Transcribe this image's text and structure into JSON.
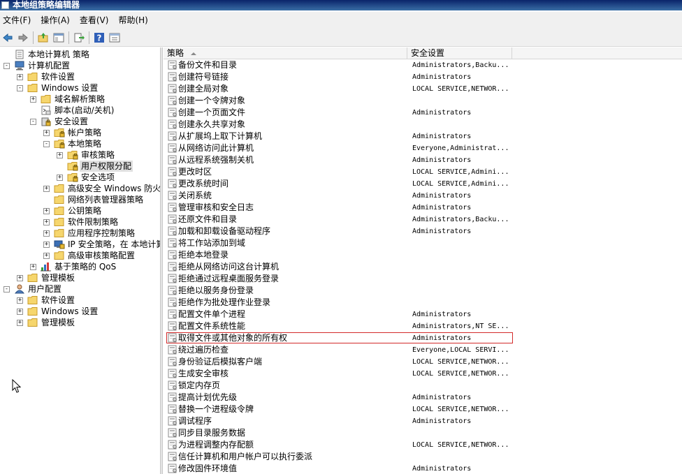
{
  "window": {
    "title": "本地组策略编辑器"
  },
  "menu": [
    "文件(F)",
    "操作(A)",
    "查看(V)",
    "帮助(H)"
  ],
  "toolbar": {
    "buttons": [
      "back-icon",
      "forward-icon",
      "up-folder-icon",
      "show-hide-tree-icon",
      "export-list-icon",
      "help-icon",
      "properties-view-icon"
    ]
  },
  "tree": [
    {
      "label": "本地计算机 策略",
      "depth": 0,
      "expander": "",
      "icon": "policy-doc-icon"
    },
    {
      "label": "计算机配置",
      "depth": 0,
      "expander": "-",
      "icon": "computer-icon"
    },
    {
      "label": "软件设置",
      "depth": 1,
      "expander": "+",
      "icon": "folder-icon"
    },
    {
      "label": "Windows 设置",
      "depth": 1,
      "expander": "-",
      "icon": "folder-icon"
    },
    {
      "label": "域名解析策略",
      "depth": 2,
      "expander": "+",
      "icon": "folder-icon"
    },
    {
      "label": "脚本(启动/关机)",
      "depth": 2,
      "expander": "",
      "icon": "script-icon"
    },
    {
      "label": "安全设置",
      "depth": 2,
      "expander": "-",
      "icon": "security-settings-icon"
    },
    {
      "label": "帐户策略",
      "depth": 3,
      "expander": "+",
      "icon": "secure-folder-icon"
    },
    {
      "label": "本地策略",
      "depth": 3,
      "expander": "-",
      "icon": "secure-folder-icon"
    },
    {
      "label": "审核策略",
      "depth": 4,
      "expander": "+",
      "icon": "secure-folder-icon"
    },
    {
      "label": "用户权限分配",
      "depth": 4,
      "expander": "",
      "icon": "secure-folder-icon",
      "selected": true
    },
    {
      "label": "安全选项",
      "depth": 4,
      "expander": "+",
      "icon": "secure-folder-icon"
    },
    {
      "label": "高级安全 Windows 防火墙",
      "depth": 3,
      "expander": "+",
      "icon": "folder-icon"
    },
    {
      "label": "网络列表管理器策略",
      "depth": 3,
      "expander": "",
      "icon": "folder-icon"
    },
    {
      "label": "公钥策略",
      "depth": 3,
      "expander": "+",
      "icon": "folder-icon"
    },
    {
      "label": "软件限制策略",
      "depth": 3,
      "expander": "+",
      "icon": "folder-icon"
    },
    {
      "label": "应用程序控制策略",
      "depth": 3,
      "expander": "+",
      "icon": "folder-icon"
    },
    {
      "label": "IP 安全策略，在 本地计算机",
      "depth": 3,
      "expander": "+",
      "icon": "ip-security-icon"
    },
    {
      "label": "高级审核策略配置",
      "depth": 3,
      "expander": "+",
      "icon": "folder-icon"
    },
    {
      "label": "基于策略的 QoS",
      "depth": 2,
      "expander": "+",
      "icon": "qos-chart-icon"
    },
    {
      "label": "管理模板",
      "depth": 1,
      "expander": "+",
      "icon": "folder-icon"
    },
    {
      "label": "用户配置",
      "depth": 0,
      "expander": "-",
      "icon": "user-icon"
    },
    {
      "label": "软件设置",
      "depth": 1,
      "expander": "+",
      "icon": "folder-icon"
    },
    {
      "label": "Windows 设置",
      "depth": 1,
      "expander": "+",
      "icon": "folder-icon"
    },
    {
      "label": "管理模板",
      "depth": 1,
      "expander": "+",
      "icon": "folder-icon"
    }
  ],
  "list": {
    "columns": [
      "策略",
      "安全设置"
    ],
    "rows": [
      {
        "policy": "备份文件和目录",
        "setting": "Administrators,Backu..."
      },
      {
        "policy": "创建符号链接",
        "setting": "Administrators"
      },
      {
        "policy": "创建全局对象",
        "setting": "LOCAL SERVICE,NETWOR..."
      },
      {
        "policy": "创建一个令牌对象",
        "setting": ""
      },
      {
        "policy": "创建一个页面文件",
        "setting": "Administrators"
      },
      {
        "policy": "创建永久共享对象",
        "setting": ""
      },
      {
        "policy": "从扩展坞上取下计算机",
        "setting": "Administrators"
      },
      {
        "policy": "从网络访问此计算机",
        "setting": "Everyone,Administrat..."
      },
      {
        "policy": "从远程系统强制关机",
        "setting": "Administrators"
      },
      {
        "policy": "更改时区",
        "setting": "LOCAL SERVICE,Admini..."
      },
      {
        "policy": "更改系统时间",
        "setting": "LOCAL SERVICE,Admini..."
      },
      {
        "policy": "关闭系统",
        "setting": "Administrators"
      },
      {
        "policy": "管理审核和安全日志",
        "setting": "Administrators"
      },
      {
        "policy": "还原文件和目录",
        "setting": "Administrators,Backu..."
      },
      {
        "policy": "加载和卸载设备驱动程序",
        "setting": "Administrators"
      },
      {
        "policy": "将工作站添加到域",
        "setting": ""
      },
      {
        "policy": "拒绝本地登录",
        "setting": ""
      },
      {
        "policy": "拒绝从网络访问这台计算机",
        "setting": ""
      },
      {
        "policy": "拒绝通过远程桌面服务登录",
        "setting": ""
      },
      {
        "policy": "拒绝以服务身份登录",
        "setting": ""
      },
      {
        "policy": "拒绝作为批处理作业登录",
        "setting": ""
      },
      {
        "policy": "配置文件单个进程",
        "setting": "Administrators"
      },
      {
        "policy": "配置文件系统性能",
        "setting": "Administrators,NT SE..."
      },
      {
        "policy": "取得文件或其他对象的所有权",
        "setting": "Administrators",
        "highlighted": true
      },
      {
        "policy": "绕过遍历检查",
        "setting": "Everyone,LOCAL SERVI..."
      },
      {
        "policy": "身份验证后模拟客户端",
        "setting": "LOCAL SERVICE,NETWOR..."
      },
      {
        "policy": "生成安全审核",
        "setting": "LOCAL SERVICE,NETWOR..."
      },
      {
        "policy": "锁定内存页",
        "setting": ""
      },
      {
        "policy": "提高计划优先级",
        "setting": "Administrators"
      },
      {
        "policy": "替换一个进程级令牌",
        "setting": "LOCAL SERVICE,NETWOR..."
      },
      {
        "policy": "调试程序",
        "setting": "Administrators"
      },
      {
        "policy": "同步目录服务数据",
        "setting": ""
      },
      {
        "policy": "为进程调整内存配额",
        "setting": "LOCAL SERVICE,NETWOR..."
      },
      {
        "policy": "信任计算机和用户帐户可以执行委派",
        "setting": ""
      },
      {
        "policy": "修改固件环境值",
        "setting": "Administrators"
      }
    ]
  },
  "colors": {
    "titlebar": "#0a246a",
    "highlight_border": "#d32a2a",
    "folder": "#f6d66d",
    "selection": "#e0e0e0"
  }
}
